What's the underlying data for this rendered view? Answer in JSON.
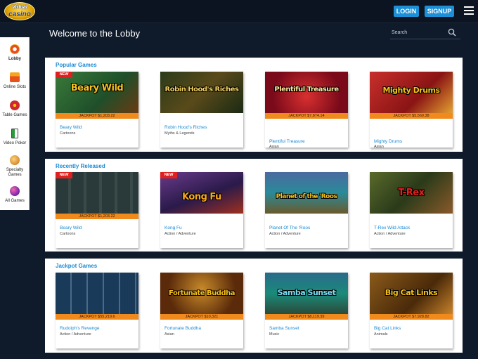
{
  "header": {
    "logo_top": "Virtual",
    "logo_bottom": "casino",
    "login": "LOGIN",
    "signup": "SIGNUP"
  },
  "sidebar": {
    "items": [
      {
        "label": "Lobby"
      },
      {
        "label": "Online Slots"
      },
      {
        "label": "Table Games"
      },
      {
        "label": "Video Poker"
      },
      {
        "label": "Specialty Games"
      },
      {
        "label": "All Games"
      }
    ]
  },
  "page_title": "Welcome to the Lobby",
  "search": {
    "placeholder": "Search"
  },
  "sections": [
    {
      "title": "Popular Games",
      "cards": [
        {
          "name": "Beary Wild",
          "category": "Cartoons",
          "jackpot": "JACKPOT $1,203.22",
          "badge": "NEW",
          "art": "Beary Wild"
        },
        {
          "name": "Robin Hood's Riches",
          "category": "Myths & Legends",
          "jackpot": "",
          "badge": "",
          "art": "Robin Hood's Riches"
        },
        {
          "name": "Plentiful Treasure",
          "category": "Asian",
          "jackpot": "JACKPOT $7,874.14",
          "badge": "",
          "art": "Plentiful Treasure"
        },
        {
          "name": "Mighty Drums",
          "category": "Asian",
          "jackpot": "JACKPOT $5,569.38",
          "badge": "",
          "art": "Mighty Drums"
        }
      ]
    },
    {
      "title": "Recently Released",
      "cards": [
        {
          "name": "Beary Wild",
          "category": "Cartoons",
          "jackpot": "JACKPOT $1,203.22",
          "badge": "NEW",
          "art": ""
        },
        {
          "name": "Kong Fu",
          "category": "Action / Adventure",
          "jackpot": "",
          "badge": "NEW",
          "art": "Kong Fu"
        },
        {
          "name": "Planet Of The 'Roos",
          "category": "Action / Adventure",
          "jackpot": "",
          "badge": "",
          "art": "Planet of the 'Roos"
        },
        {
          "name": "T-Rex Wild Attack",
          "category": "Action / Adventure",
          "jackpot": "",
          "badge": "",
          "art": "T-Rex"
        }
      ]
    },
    {
      "title": "Jackpot Games",
      "cards": [
        {
          "name": "Rudolph's Revenge",
          "category": "Action / Adventure",
          "jackpot": "JACKPOT $55,219.6",
          "badge": "",
          "art": ""
        },
        {
          "name": "Fortunate Buddha",
          "category": "Asian",
          "jackpot": "JACKPOT $10,321",
          "badge": "",
          "art": "Fortunate Buddha"
        },
        {
          "name": "Samba Sunset",
          "category": "Music",
          "jackpot": "JACKPOT $8,119.39",
          "badge": "",
          "art": "Samba Sunset"
        },
        {
          "name": "Big Cat Links",
          "category": "Animals",
          "jackpot": "JACKPOT $7,928.82",
          "badge": "",
          "art": "Big Cat Links"
        }
      ]
    }
  ],
  "colors": {
    "accent": "#1a8ad4",
    "jackpot_bar": "#f08a1c",
    "new_badge": "#e02020",
    "background": "#0f1b2b"
  }
}
